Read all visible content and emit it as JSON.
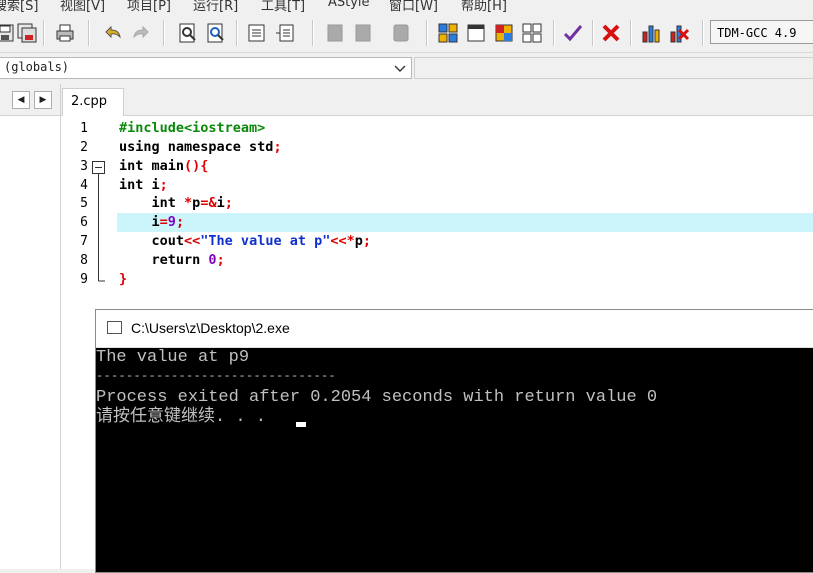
{
  "menu": {
    "items": [
      "搜索[S]",
      "视图[V]",
      "项目[P]",
      "运行[R]",
      "工具[T]",
      "AStyle",
      "窗口[W]",
      "帮助[H]"
    ]
  },
  "toolbar": {
    "compiler_label": "TDM-GCC 4.9"
  },
  "scope": {
    "value": "(globals)"
  },
  "editor": {
    "tab_label": "2.cpp",
    "line_numbers": [
      "1",
      "2",
      "3",
      "4",
      "5",
      "6",
      "7",
      "8",
      "9"
    ]
  },
  "console": {
    "title": "C:\\Users\\z\\Desktop\\2.exe",
    "lines": [
      "The value at p9",
      "--------------------------------",
      "Process exited after 0.2054 seconds with return value 0",
      "请按任意键继续. . ."
    ]
  },
  "colors": {
    "current_line": "#ccf5fb",
    "preprocessor": "#0a8a0a",
    "symbol": "#e00000",
    "string": "#1030cc",
    "number": "#8000c0"
  }
}
